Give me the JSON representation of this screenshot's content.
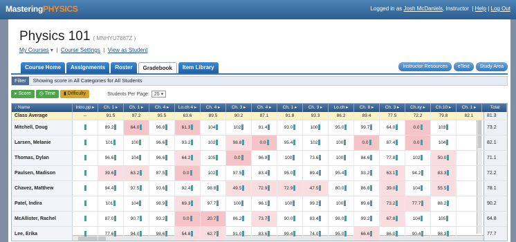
{
  "app": {
    "logo_a": "Mastering",
    "logo_b": "PHYSICS"
  },
  "user": {
    "prefix": "Logged in as",
    "name": "Josh McDaniels",
    "role": ", Instructor",
    "help": "Help",
    "logout": "Log Out"
  },
  "course": {
    "title": "Physics 101",
    "id": "( MNHYU7887Z )",
    "my_courses": "My Courses",
    "settings": "Course Settings",
    "view_student": "View as Student"
  },
  "tabs": [
    "Course Home",
    "Assignments",
    "Roster",
    "Gradebook",
    "Item Library"
  ],
  "active_tab": "Gradebook",
  "right_tabs": [
    "Instructor Resources",
    "eText",
    "Study Area"
  ],
  "filter": {
    "button": "Filter",
    "text": "Showing score in All Categories for All Students"
  },
  "toolbar": {
    "score": "Score",
    "time": "Time",
    "difficulty": "Difficulty",
    "per_page_label": "Students Per Page:",
    "per_page_value": "25"
  },
  "columns": [
    "Intro.pp",
    "Ch. 1",
    "Ch. 1",
    "Ch. 4",
    "Lo.ch 4",
    "Ch. 4",
    "Ch. 3",
    "Ch. 4",
    "Ch. 1",
    "Ch. 3",
    "Lo.ch",
    "Ch. 8",
    "Ch. 3",
    "Ch.xy",
    "Ch.10",
    "Ch. 1"
  ],
  "name_header": "Name",
  "total_header": "Total",
  "rows": [
    {
      "name": "Class Average",
      "avg": true,
      "cells": [
        "--",
        "91.5",
        "97.2",
        "95.5",
        "63.6",
        "89.5",
        "90.2",
        "87.1",
        "91.8",
        "93.3",
        "86.2",
        "89.4",
        "77.5",
        "72.2",
        "79.8",
        "82.1"
      ],
      "total": "81.3"
    },
    {
      "name": "Mitchell, Doug",
      "cells": [
        "",
        "89.2",
        "64.0",
        "96.8",
        "61.3",
        "104",
        "102",
        "91.4",
        "93.0",
        "100",
        "95.0",
        "99.7",
        "64.0",
        "0.0",
        "103",
        ""
      ],
      "total": "73.2",
      "low": [
        2,
        4,
        13
      ],
      "mid": []
    },
    {
      "name": "Larsen, Melanie",
      "cells": [
        "",
        "101",
        "100",
        "96.6",
        "93.2",
        "102",
        "98.8",
        "0.0",
        "95.4",
        "102",
        "100",
        "0.0",
        "87.4",
        "0.0",
        "104",
        ""
      ],
      "total": "82.1",
      "low": [
        7,
        11,
        13
      ],
      "mid": [
        6
      ]
    },
    {
      "name": "Thomas, Dylan",
      "cells": [
        "",
        "96.6",
        "104",
        "96.6",
        "64.2",
        "105",
        "0.0",
        "96.9",
        "100",
        "73.6",
        "100",
        "84.6",
        "77.8",
        "102",
        "50.0",
        ""
      ],
      "total": "71.1",
      "low": [
        6
      ],
      "mid": [
        4,
        14
      ]
    },
    {
      "name": "Paulsen, Madison",
      "cells": [
        "",
        "39.6",
        "63.2",
        "87.5",
        "0.0",
        "102",
        "97.5",
        "83.4",
        "95.0",
        "89.4",
        "95.4",
        "93.2",
        "63.1",
        "94.2",
        "83.3",
        ""
      ],
      "total": "72.2",
      "low": [
        4
      ],
      "mid": [
        1,
        2,
        12,
        14
      ]
    },
    {
      "name": "Chavez, Matthew",
      "cells": [
        "",
        "94.4",
        "97.5",
        "93.6",
        "92.4",
        "98.8",
        "49.5",
        "72.9",
        "72.9",
        "47.5",
        "80.0",
        "86.8",
        "39.0",
        "104",
        "55.5",
        ""
      ],
      "total": "78.1",
      "low": [],
      "mid": [
        6,
        7,
        8,
        9,
        12,
        14
      ]
    },
    {
      "name": "Patel, Indira",
      "cells": [
        "",
        "101",
        "104",
        "98.9",
        "69.3",
        "97.7",
        "100",
        "96.1",
        "100",
        "99.2",
        "100",
        "89.6",
        "73.2",
        "77.7",
        "88.2",
        ""
      ],
      "total": "90.2",
      "low": [],
      "mid": [
        4,
        12,
        13
      ]
    },
    {
      "name": "McAllister, Rachel",
      "cells": [
        "",
        "87.0",
        "90.7",
        "93.2",
        "0.0",
        "20.7",
        "86.2",
        "73.7",
        "90.0",
        "83.4",
        "98.0",
        "99.2",
        "67.8",
        "104",
        "105",
        ""
      ],
      "total": "64.8",
      "low": [
        4,
        5
      ],
      "mid": [
        7,
        12
      ]
    },
    {
      "name": "Lee, Erika",
      "cells": [
        "",
        "77.6",
        "94.0",
        "98.6",
        "54.8",
        "62.7",
        "91.0",
        "83.6",
        "99.4",
        "74.0",
        "95.0",
        "66.6",
        "86.0",
        "90.4",
        "98.3",
        ""
      ],
      "total": "77.7",
      "low": [],
      "mid": [
        4,
        5,
        11
      ]
    }
  ]
}
